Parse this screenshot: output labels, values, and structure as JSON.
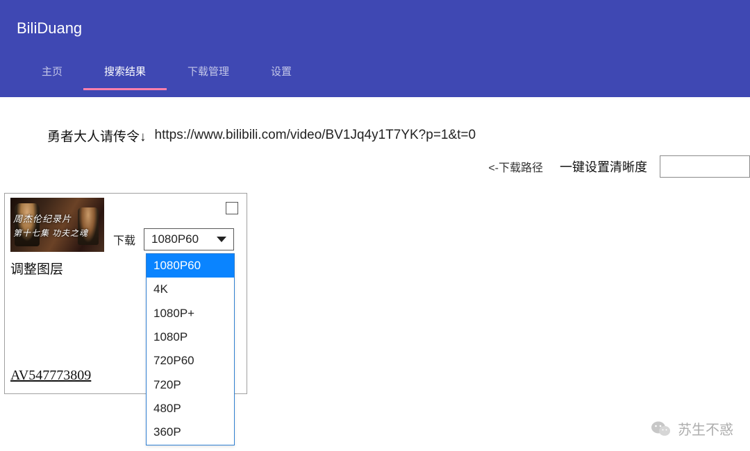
{
  "header": {
    "title": "BiliDuang",
    "tabs": [
      {
        "label": "主页",
        "active": false
      },
      {
        "label": "搜索结果",
        "active": true
      },
      {
        "label": "下载管理",
        "active": false
      },
      {
        "label": "设置",
        "active": false
      }
    ]
  },
  "search": {
    "label": "勇者大人请传令↓",
    "value": "https://www.bilibili.com/video/BV1Jq4y1T7YK?p=1&t=0"
  },
  "toolbar": {
    "path_label": "<-下载路径",
    "quality_label": "一键设置清晰度"
  },
  "card": {
    "thumb_overlay_line1": "周杰伦纪录片",
    "thumb_overlay_line2": "第十七集 功夫之魂",
    "download_label": "下载",
    "selected_quality": "1080P60",
    "quality_options": [
      "1080P60",
      "4K",
      "1080P+",
      "1080P",
      "720P60",
      "720P",
      "480P",
      "360P"
    ],
    "title": "调整图层",
    "video_id": "AV547773809"
  },
  "watermark": {
    "text": "苏生不惑"
  }
}
